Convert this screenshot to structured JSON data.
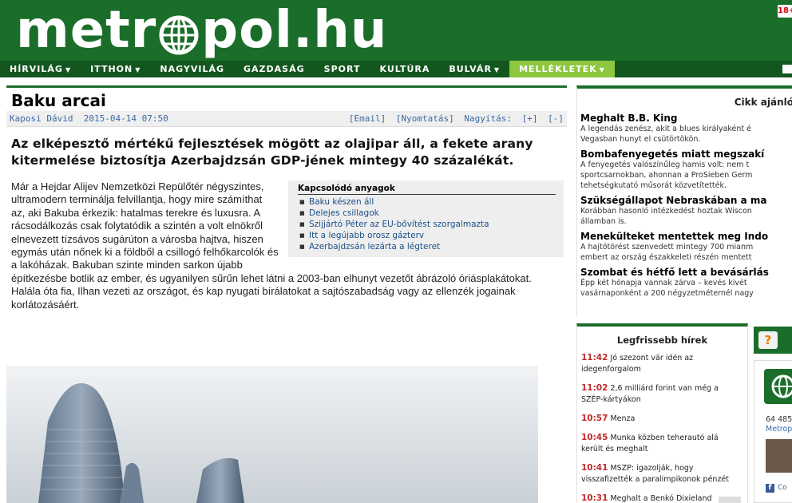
{
  "header": {
    "logo_left": "metr",
    "logo_right": "pol.hu",
    "age_badge": "18+"
  },
  "nav": {
    "items": [
      {
        "label": "HÍRVILÁG",
        "dropdown": true
      },
      {
        "label": "ITTHON",
        "dropdown": true
      },
      {
        "label": "NAGYVILÁG",
        "dropdown": false
      },
      {
        "label": "GAZDASÁG",
        "dropdown": false
      },
      {
        "label": "SPORT",
        "dropdown": false
      },
      {
        "label": "KULTÚRA",
        "dropdown": false
      },
      {
        "label": "BULVÁR",
        "dropdown": true
      },
      {
        "label": "MELLÉKLETEK",
        "dropdown": true
      }
    ],
    "active_index": 7
  },
  "article": {
    "title": "Baku arcai",
    "author": "Kaposi Dávid",
    "date": "2015-04-14 07:50",
    "tools": {
      "email": "[Email]",
      "print": "[Nyomtatás]",
      "zoom_label": "Nagyítás:",
      "zoom_in": "[+]",
      "zoom_out": "[-]"
    },
    "lead": "Az elképesztő mértékű fejlesztések mögött az olajipar áll, a fekete arany kitermelése biztosítja Azerbajdzsán GDP-jének mintegy 40 százalékát.",
    "body": "Már a Hejdar Alijev Nemzetközi Repülőtér négyszintes, ultramodern terminálja felvillantja, hogy mire számíthat az, aki Bakuba érkezik: hatalmas terekre és luxusra. A rácsodálkozás csak folytatódik a szintén a volt elnökről elnevezett tízsávos sugárúton a városba hajtva, hiszen egymás után nőnek ki a földből a csillogó felhőkarcolók és a lakóházak. Bakuban szinte minden sarkon újabb építkezésbe botlik az ember, és ugyanilyen sűrűn lehet látni a 2003-ban elhunyt vezetőt ábrázoló óriásplakátokat. Halála óta fia, Ilhan vezeti az országot, és kap nyugati bírálatokat a sajtószabadság vagy az ellenzék jogainak korlátozásáért.",
    "related": {
      "heading": "Kapcsolódó anyagok",
      "items": [
        "Baku készen áll",
        "Delejes csillagok",
        "Szijjártó Péter az EU-bővítést szorgalmazta",
        "Itt a legújabb orosz gázterv",
        "Azerbajdzsán lezárta a légteret"
      ]
    }
  },
  "sidebar": {
    "heading": "Cikk ajánló",
    "items": [
      {
        "title": "Meghalt B.B. King",
        "desc": [
          "A legendás zenész, akit a blues királyaként é",
          "Vegasban hunyt el csütörtökön."
        ]
      },
      {
        "title": "Bombafenyegetés miatt megszakí",
        "desc": [
          "A fenyegetés valószínűleg hamis volt: nem t",
          "sportcsarnokban, ahonnan a ProSieben Germ",
          "tehetségkutató műsorát közvetítették."
        ]
      },
      {
        "title": "Szükségállapot Nebraskában a ma",
        "desc": [
          "Korábban hasonló intézkedést hoztak Wiscon",
          "államban is."
        ]
      },
      {
        "title": "Menekülteket mentettek meg Indo",
        "desc": [
          "A hajtótörést szenvedett mintegy 700 mianm",
          "embert az ország északkeleti részén mentett"
        ]
      },
      {
        "title": "Szombat és hétfő lett a bevásárlás",
        "desc": [
          "Épp két hónapja vannak zárva – kevés kivét",
          "vasárnaponként a 200 négyzetméternél nagy"
        ]
      }
    ]
  },
  "news": {
    "heading": "Legfrissebb hírek",
    "items": [
      {
        "time": "11:42",
        "text": "Jó szezont vár idén az idegenforgalom"
      },
      {
        "time": "11:02",
        "text": "2,6 milliárd forint van még a SZÉP-kártyákon"
      },
      {
        "time": "10:57",
        "text": "Menza"
      },
      {
        "time": "10:45",
        "text": "Munka közben teherautó alá került és meghalt"
      },
      {
        "time": "10:41",
        "text": "MSZP: igazolják, hogy visszafizették a paralimpikonok pénzét"
      },
      {
        "time": "10:31",
        "text": "Meghalt a Benkó Dixieland"
      }
    ]
  },
  "widget": {
    "quiz_mark": "?",
    "number": "64 485",
    "name": "Metrop",
    "fb": "Co"
  }
}
